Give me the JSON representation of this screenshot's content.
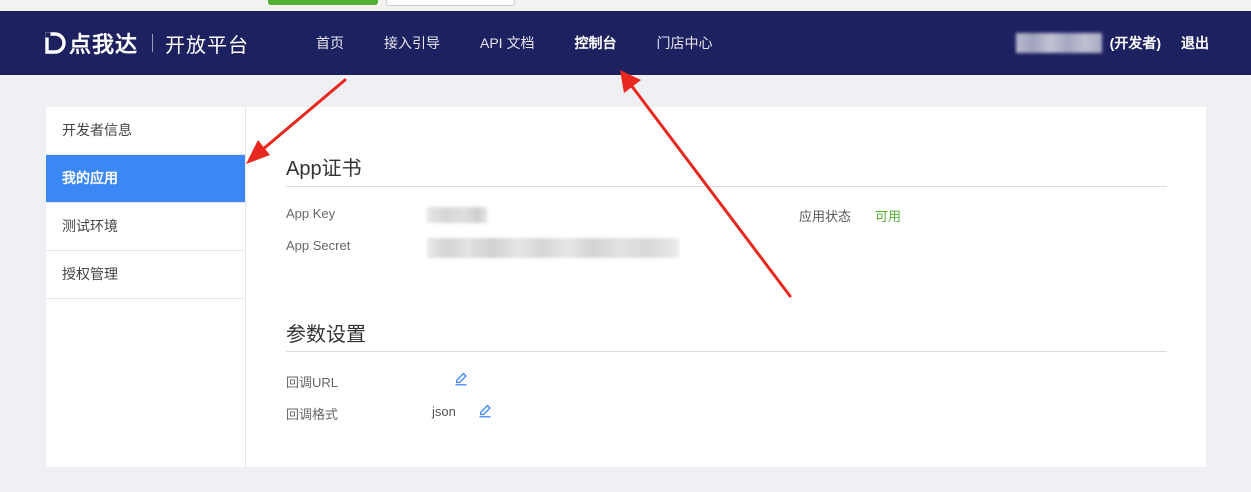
{
  "header": {
    "brand": "点我达",
    "platform": "开放平台",
    "nav": [
      "首页",
      "接入引导",
      "API 文档",
      "控制台",
      "门店中心"
    ],
    "active_nav": "控制台",
    "user_role": "(开发者)",
    "logout": "退出"
  },
  "sidebar": {
    "items": [
      {
        "label": "开发者信息",
        "active": false
      },
      {
        "label": "我的应用",
        "active": true
      },
      {
        "label": "测试环境",
        "active": false
      },
      {
        "label": "授权管理",
        "active": false
      }
    ]
  },
  "app_cert": {
    "title": "App证书",
    "app_key_label": "App Key",
    "app_secret_label": "App Secret",
    "status_label": "应用状态",
    "status_value": "可用"
  },
  "params": {
    "title": "参数设置",
    "callback_url_label": "回调URL",
    "callback_format_label": "回调格式",
    "callback_format_value": "json"
  },
  "colors": {
    "header_bg": "#1e2160",
    "accent_blue": "#3a87f5",
    "status_green": "#52b030",
    "annotation_red": "#e8281e"
  },
  "icons": {
    "edit": "pencil-icon",
    "logo": "dianwoda-logo-mark"
  }
}
